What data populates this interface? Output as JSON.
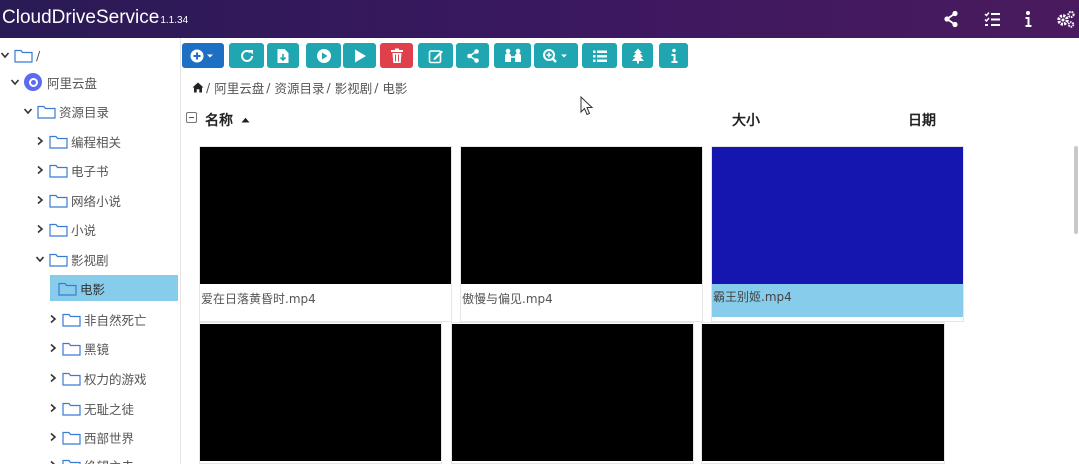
{
  "app": {
    "title": "CloudDriveService",
    "version": "1.1.34"
  },
  "header_icons": [
    "share-icon",
    "task-list-icon",
    "info-icon",
    "settings-icon"
  ],
  "tree": [
    {
      "label": "/",
      "icon": "folder-icon",
      "expanded": true,
      "level": 0
    },
    {
      "label": "阿里云盘",
      "icon": "aliyun-logo",
      "expanded": true,
      "level": 1
    },
    {
      "label": "资源目录",
      "icon": "folder-icon",
      "expanded": true,
      "level": 2
    },
    {
      "label": "编程相关",
      "icon": "folder-icon",
      "expanded": false,
      "level": 3
    },
    {
      "label": "电子书",
      "icon": "folder-icon",
      "expanded": false,
      "level": 3
    },
    {
      "label": "网络小说",
      "icon": "folder-icon",
      "expanded": false,
      "level": 3
    },
    {
      "label": "小说",
      "icon": "folder-icon",
      "expanded": false,
      "level": 3
    },
    {
      "label": "影视剧",
      "icon": "folder-icon",
      "expanded": true,
      "level": 3
    },
    {
      "label": "电影",
      "icon": "folder-icon",
      "selected": true,
      "level": 4
    },
    {
      "label": "非自然死亡",
      "icon": "folder-icon",
      "expanded": false,
      "level": 4
    },
    {
      "label": "黑镜",
      "icon": "folder-icon",
      "expanded": false,
      "level": 4
    },
    {
      "label": "权力的游戏",
      "icon": "folder-icon",
      "expanded": false,
      "level": 4
    },
    {
      "label": "无耻之徒",
      "icon": "folder-icon",
      "expanded": false,
      "level": 4
    },
    {
      "label": "西部世界",
      "icon": "folder-icon",
      "expanded": false,
      "level": 4
    },
    {
      "label": "绝望主夫",
      "icon": "folder-icon",
      "expanded": false,
      "level": 4
    }
  ],
  "toolbar": [
    {
      "name": "add-menu-button",
      "icon": "plus-circle-icon",
      "color": "#1d6fc3"
    },
    {
      "name": "refresh-button",
      "icon": "refresh-icon",
      "color": "#20a6b0"
    },
    {
      "name": "upload-file-button",
      "icon": "file-upload-icon",
      "color": "#20a6b0"
    },
    {
      "name": "play-circle-button",
      "icon": "play-circle-icon",
      "color": "#20a6b0"
    },
    {
      "name": "play-button",
      "icon": "play-icon",
      "color": "#20a6b0"
    },
    {
      "name": "delete-button",
      "icon": "trash-icon",
      "color": "#e0404b"
    },
    {
      "name": "rename-button",
      "icon": "edit-icon",
      "color": "#20a6b0"
    },
    {
      "name": "share-button",
      "icon": "share-icon",
      "color": "#20a6b0"
    },
    {
      "name": "move-button",
      "icon": "people-icon",
      "color": "#20a6b0"
    },
    {
      "name": "zoom-menu-button",
      "icon": "zoom-icon",
      "color": "#20a6b0"
    },
    {
      "name": "list-view-button",
      "icon": "list-icon",
      "color": "#20a6b0"
    },
    {
      "name": "tree-view-button",
      "icon": "tree-icon",
      "color": "#20a6b0"
    },
    {
      "name": "info-button",
      "icon": "info-icon",
      "color": "#20a6b0"
    }
  ],
  "breadcrumb": [
    "阿里云盘",
    "资源目录",
    "影视剧",
    "电影"
  ],
  "columns": {
    "name": "名称",
    "size": "大小",
    "date": "日期"
  },
  "files": [
    {
      "name": "爱在日落黄昏时.mp4",
      "thumb_color": "#000000"
    },
    {
      "name": "傲慢与偏见.mp4",
      "thumb_color": "#000000"
    },
    {
      "name": "霸王别姬.mp4",
      "thumb_color": "#1515b0",
      "selected": true
    },
    {
      "name": "",
      "thumb_color": "#000000"
    },
    {
      "name": "",
      "thumb_color": "#000000"
    },
    {
      "name": "",
      "thumb_color": "#000000"
    }
  ]
}
